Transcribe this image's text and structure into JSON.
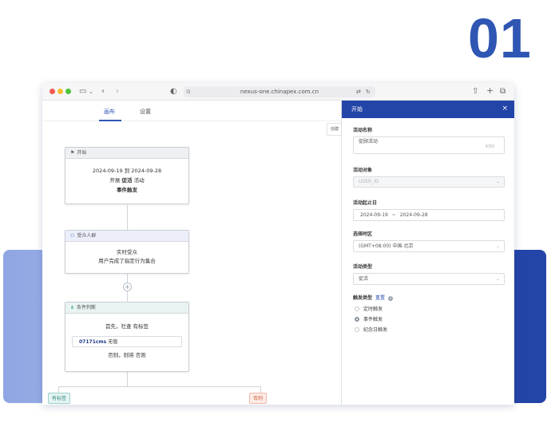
{
  "badge_number": "01",
  "browser": {
    "url": "nexus-one.chinapex.com.cn",
    "icons": {
      "sidebar": "sidebar-icon",
      "back": "chevron-left-icon",
      "forward": "chevron-right-icon",
      "shield": "shield-icon",
      "translate": "translate-icon",
      "reload": "reload-icon",
      "share": "share-icon",
      "new_tab": "plus-icon",
      "tabs": "tabs-icon"
    }
  },
  "canvas": {
    "tabs": [
      {
        "label": "画布",
        "active": true
      },
      {
        "label": "设置",
        "active": false
      }
    ],
    "partial_button": "创建",
    "start_node": {
      "title": "开始",
      "date_range": "2024-09-19 到 2024-09-28",
      "open_prefix": "开展",
      "open_name": "促活",
      "open_suffix": "活动",
      "trigger": "事件触发"
    },
    "audience_node": {
      "title": "受众人群",
      "line1": "实时受众",
      "line2": "用户完成了指定行为集合"
    },
    "condition_node": {
      "title": "条件判断",
      "line1": "首先，社查 有标签",
      "value_code": "07171cms",
      "value_suffix": "无值",
      "line3": "否则，则将 否则"
    },
    "branches": {
      "left": "有标签",
      "right": "否则"
    },
    "plus_symbol": "+"
  },
  "panel": {
    "title": "开始",
    "close_symbol": "×",
    "activity_name_label": "活动名称",
    "activity_name_value": "促顾活动",
    "activity_name_counter": "4/50",
    "target_label": "活动对象",
    "target_value": "USER_ID",
    "period_label": "活动起止日",
    "period_start": "2024-09-19",
    "period_sep": "~",
    "period_end": "2024-09-28",
    "timezone_label": "选择时区",
    "timezone_value": "(GMT+08:00) 中国-北京",
    "type_label": "活动类型",
    "type_value": "促活",
    "trigger_label": "触发类型",
    "trigger_link": "重置",
    "trigger_options": [
      {
        "label": "定时触发",
        "selected": false
      },
      {
        "label": "事件触发",
        "selected": true
      },
      {
        "label": "纪念日触发",
        "selected": false
      }
    ]
  },
  "colors": {
    "brand": "#2f56b3",
    "panel_header": "#2445a8",
    "band_light": "#8fa6e3",
    "band_dark": "#2445a8",
    "branch_left_bg": "#e6f4f3",
    "branch_right_bg": "#fdebe6"
  }
}
